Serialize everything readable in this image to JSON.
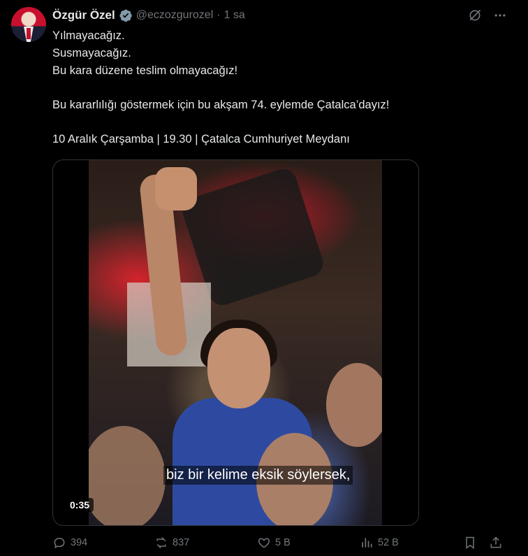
{
  "author": {
    "name": "Özgür Özel",
    "handle": "@eczozgurozel",
    "separator": "·",
    "time": "1 sa"
  },
  "post": {
    "lines": [
      "Yılmayacağız.",
      "Susmayacağız.",
      "Bu kara düzene teslim olmayacağız!",
      "",
      "Bu kararlılığı göstermek için bu akşam 74. eylemde Çatalca’dayız!",
      "",
      "10 Aralık Çarşamba | 19.30 | Çatalca Cumhuriyet Meydanı"
    ]
  },
  "video": {
    "subtitle": "biz bir kelime eksik söylersek,",
    "duration": "0:35"
  },
  "actions": {
    "replies": "394",
    "reposts": "837",
    "likes": "5 B",
    "views": "52 B"
  },
  "colors": {
    "background": "#000000",
    "text": "#e7e9ea",
    "muted": "#71767b",
    "verified": "#829aab"
  },
  "icons": [
    "avatar",
    "verified-badge-icon",
    "grok-icon",
    "more-icon",
    "reply-icon",
    "repost-icon",
    "like-icon",
    "views-icon",
    "bookmark-icon",
    "share-icon"
  ]
}
